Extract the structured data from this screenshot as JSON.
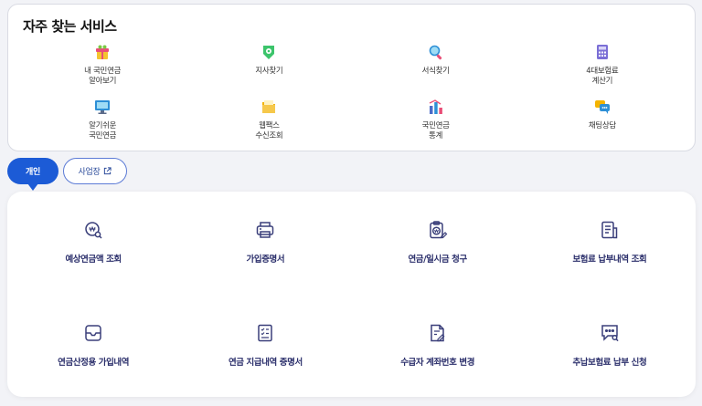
{
  "frequent": {
    "title": "자주 찾는 서비스",
    "items": [
      {
        "label": "내 국민연금\n알아보기",
        "icon": "gift-icon"
      },
      {
        "label": "지사찾기",
        "icon": "location-badge-icon"
      },
      {
        "label": "서식찾기",
        "icon": "magnifier-icon"
      },
      {
        "label": "4대보험료\n계산기",
        "icon": "calculator-icon"
      },
      {
        "label": "알기쉬운\n국민연금",
        "icon": "monitor-icon"
      },
      {
        "label": "웹팩스\n수신조회",
        "icon": "folder-icon"
      },
      {
        "label": "국민연금\n통계",
        "icon": "bar-chart-icon"
      },
      {
        "label": "채팅상담",
        "icon": "chat-bubbles-icon"
      }
    ]
  },
  "tabs": {
    "personal": "개인",
    "business": "사업장"
  },
  "services": [
    {
      "label": "예상연금액 조회",
      "icon": "won-search-icon"
    },
    {
      "label": "가입증명서",
      "icon": "printer-icon"
    },
    {
      "label": "연금/일시금 청구",
      "icon": "won-clipboard-edit-icon"
    },
    {
      "label": "보험료 납부내역 조회",
      "icon": "document-list-icon"
    },
    {
      "label": "연금산정용 가입내역",
      "icon": "inbox-icon"
    },
    {
      "label": "연금 지급내역 증명서",
      "icon": "checklist-document-icon"
    },
    {
      "label": "수급자 계좌번호 변경",
      "icon": "document-pen-icon"
    },
    {
      "label": "추납보험료 납부 신청",
      "icon": "chat-search-icon"
    }
  ],
  "colors": {
    "accent": "#1c5bd6",
    "service_label": "#2b2f6b",
    "icon_line": "#3a3f7a"
  }
}
